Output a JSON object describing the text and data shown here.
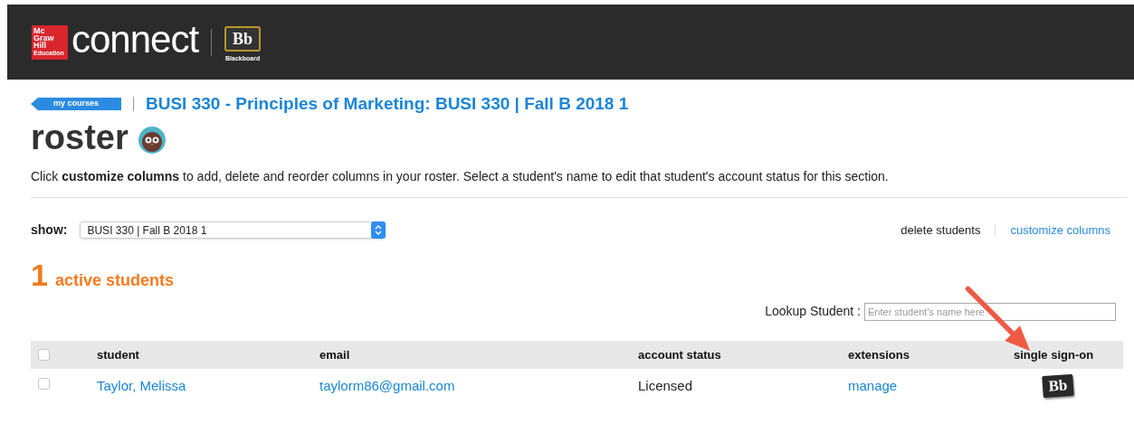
{
  "header": {
    "logo": {
      "publisher": [
        "Mc",
        "Graw",
        "Hill",
        "Education"
      ],
      "product": "connect",
      "partner_badge": "Bb",
      "partner_name": "Blackboard"
    }
  },
  "breadcrumb": {
    "back_link": "my courses",
    "course_title": "BUSI 330 - Principles of Marketing: BUSI 330 | Fall B 2018 1"
  },
  "page_title": "roster",
  "instructions": "Click **customize columns** to add, delete and reorder columns in your roster. Select a student's name to edit that student's account status for this section.",
  "filter": {
    "label": "show:",
    "value": "BUSI 330 | Fall B 2018 1"
  },
  "actions": [
    {
      "label": "delete students",
      "kind": "plain"
    },
    {
      "label": "customize columns",
      "kind": "link"
    }
  ],
  "summary": {
    "count": "1",
    "label": "active students"
  },
  "lookup": {
    "label": "Lookup Student :",
    "placeholder": "Enter student's name here"
  },
  "table": {
    "select_all_checked": false,
    "columns": [
      "student",
      "email",
      "account status",
      "extensions",
      "single sign-on"
    ],
    "rows": [
      {
        "checked": false,
        "student": "Taylor, Melissa",
        "email": "taylorm86@gmail.com",
        "account_status": "Licensed",
        "extensions": "manage",
        "single_sign_on": "Bb"
      }
    ]
  }
}
